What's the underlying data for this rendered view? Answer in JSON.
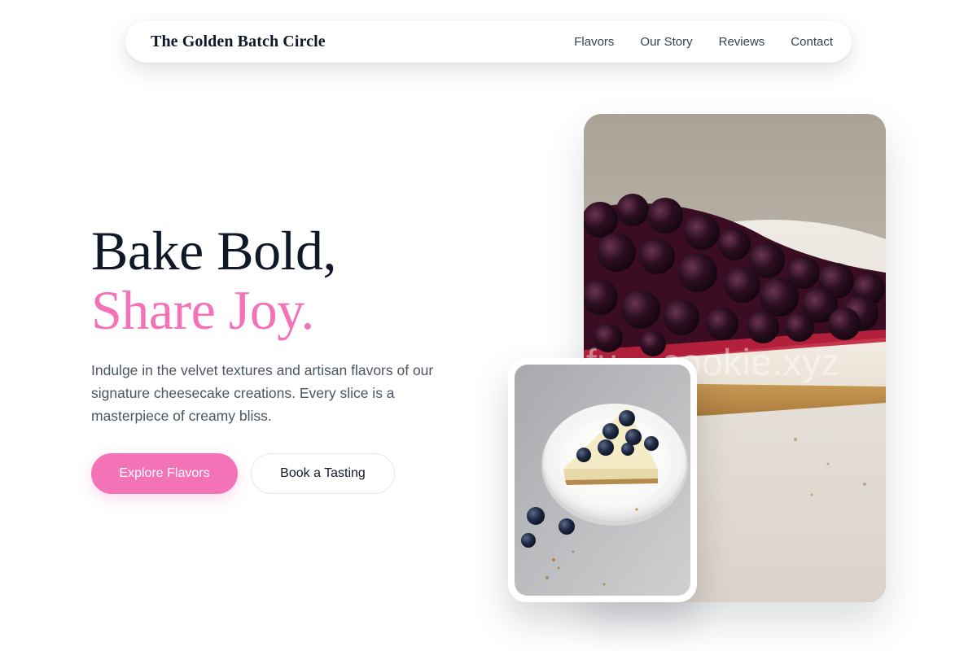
{
  "nav": {
    "brand": "The Golden Batch Circle",
    "links": [
      "Flavors",
      "Our Story",
      "Reviews",
      "Contact"
    ]
  },
  "hero": {
    "title_line1": "Bake Bold,",
    "title_line2": "Share Joy.",
    "description": "Indulge in the velvet textures and artisan flavors of our signature cheesecake creations. Every slice is a masterpiece of creamy bliss.",
    "primary_button": "Explore Flavors",
    "secondary_button": "Book a Tasting"
  },
  "images": {
    "main_alt": "Blueberry cheesecake slice close-up",
    "thumb_alt": "Cheesecake slice with blueberries on a white plate",
    "watermark": "fu... cookie.xyz"
  },
  "colors": {
    "accent": "#f472b6",
    "heading": "#111827",
    "body_text": "#4b5563"
  }
}
